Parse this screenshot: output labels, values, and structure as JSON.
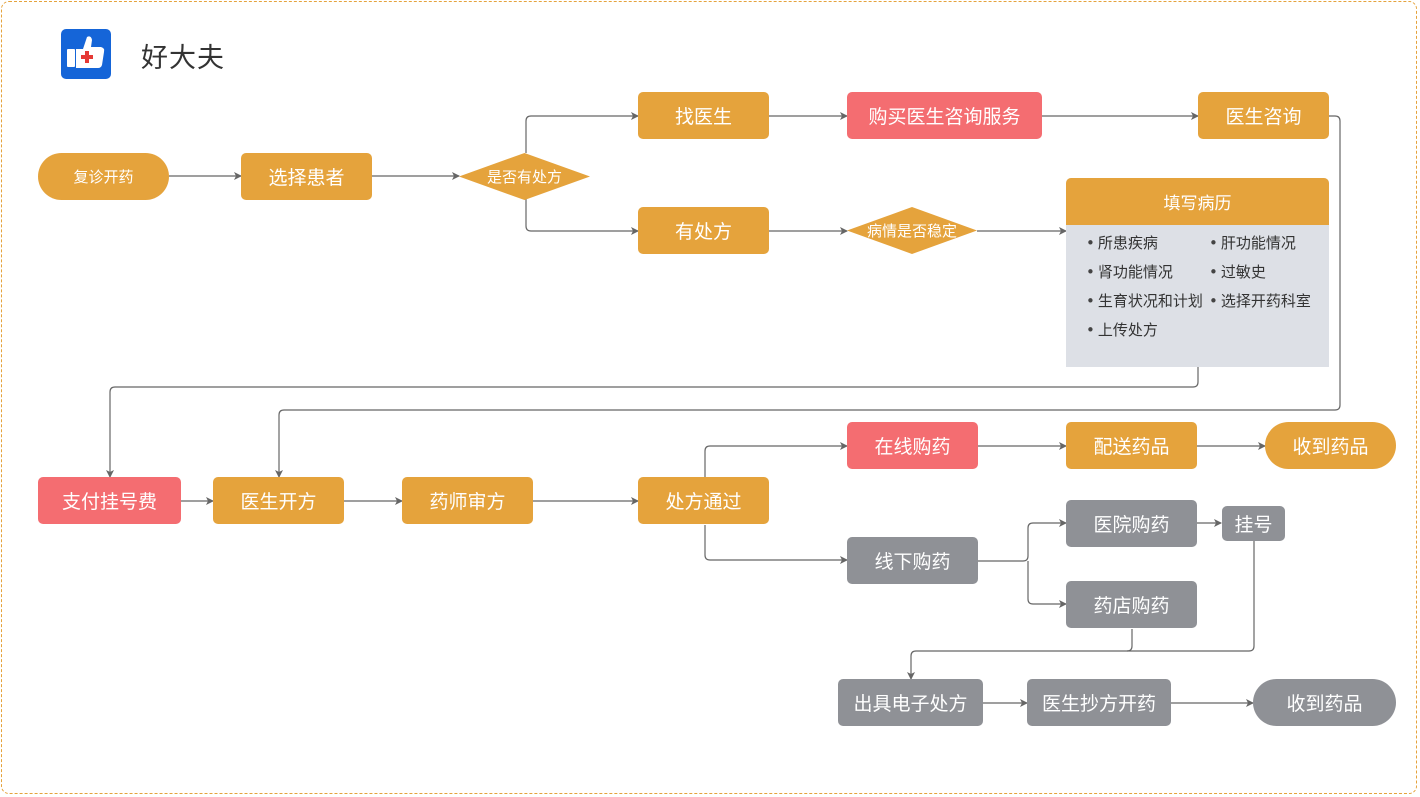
{
  "app": {
    "title": "好大夫",
    "logo_icon": "thumbs-up-medical-cross-icon"
  },
  "colors": {
    "primary": "#e5a33c",
    "highlight": "#f46d71",
    "offline": "#8f9196",
    "card_body": "#dde0e6",
    "logo_blue": "#1565d8",
    "connector": "#666666",
    "frame_border": "#e5a33c"
  },
  "nodes": {
    "start": "复诊开药",
    "select_patient": "选择患者",
    "has_prescription_q": "是否有处方",
    "find_doctor": "找医生",
    "buy_consult": "购买医生咨询服务",
    "doctor_consult": "医生咨询",
    "has_prescription": "有处方",
    "stable_q": "病情是否稳定",
    "pay_fee": "支付挂号费",
    "doctor_prescribe": "医生开方",
    "pharmacist_review": "药师审方",
    "prescription_pass": "处方通过",
    "online_buy": "在线购药",
    "deliver": "配送药品",
    "receive_online": "收到药品",
    "offline_buy": "线下购药",
    "hospital_buy": "医院购药",
    "register": "挂号",
    "pharmacy_buy": "药店购药",
    "e_prescription": "出具电子处方",
    "doctor_copy": "医生抄方开药",
    "receive_offline": "收到药品"
  },
  "medical_record": {
    "title": "填写病历",
    "items": [
      "所患疾病",
      "肝功能情况",
      "肾功能情况",
      "过敏史",
      "生育状况和计划",
      "选择开药科室",
      "上传处方"
    ]
  }
}
